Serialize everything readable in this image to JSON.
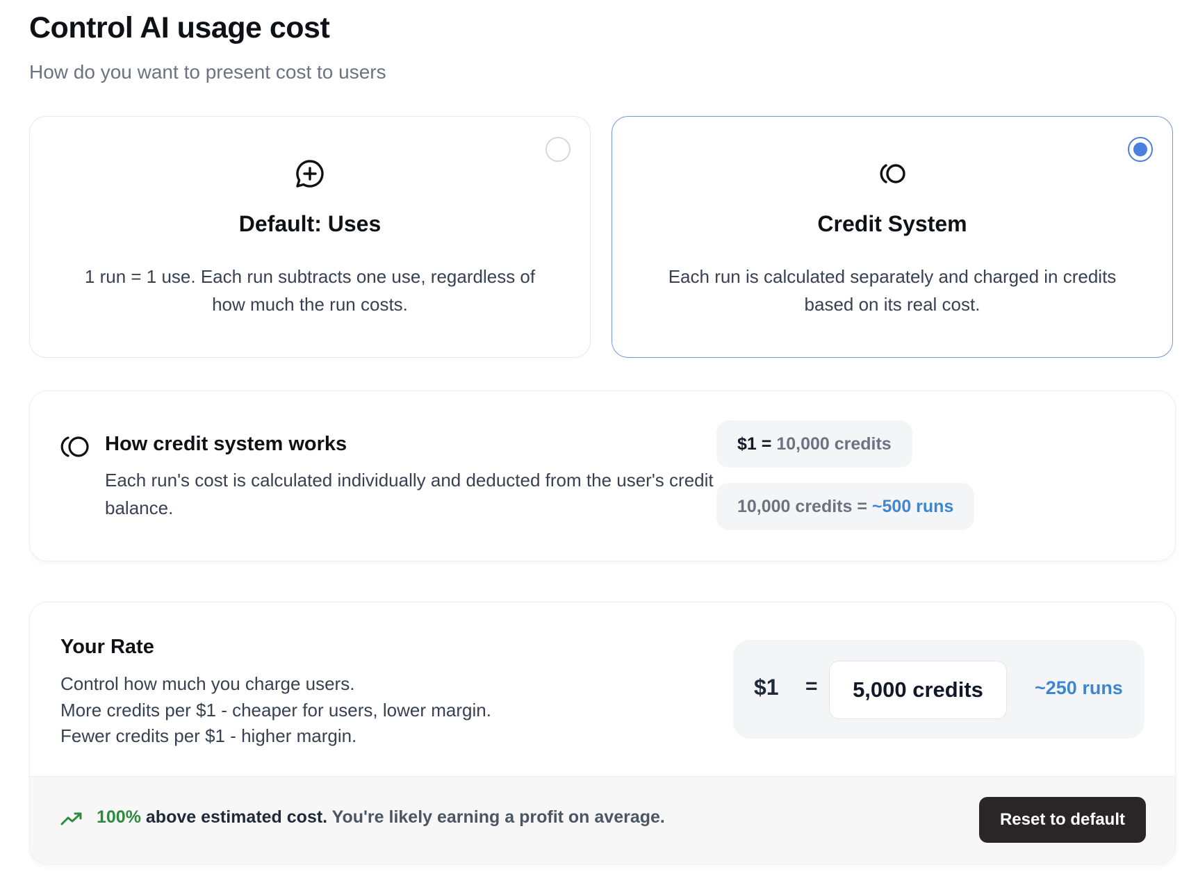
{
  "header": {
    "title": "Control AI usage cost",
    "subtitle": "How do you want to present cost to users"
  },
  "options": [
    {
      "icon": "message-plus-icon",
      "title": "Default: Uses",
      "description": "1 run = 1 use. Each run subtracts one use, regardless of how much the run costs.",
      "selected": false
    },
    {
      "icon": "credits-icon",
      "title": "Credit System",
      "description": "Each run is calculated separately and charged in credits based on its real cost.",
      "selected": true
    }
  ],
  "info": {
    "icon": "credits-icon",
    "title": "How credit system works",
    "description": "Each run's cost is calculated individually and deducted from the user's credit balance.",
    "pill_1": {
      "dollar": "$1",
      "equals": " = ",
      "credits": "10,000 credits"
    },
    "pill_2": {
      "credits": "10,000 credits",
      "equals": " = ",
      "runs": "~500 runs"
    }
  },
  "rate": {
    "title": "Your Rate",
    "line_1": "Control how much you charge users.",
    "line_2": "More credits per $1 - cheaper for users, lower margin.",
    "line_3": "Fewer credits per $1 - higher margin.",
    "dollar": "$1",
    "equals": "=",
    "credits_value": "5,000 credits",
    "runs": "~250 runs"
  },
  "footer": {
    "icon": "trending-up-icon",
    "percent": "100%",
    "above_text": "above estimated cost.",
    "profit_text": "You're likely earning a profit on average.",
    "reset_label": "Reset to default"
  },
  "colors": {
    "accent_blue": "#4a7fe0",
    "link_blue": "#3f86d0",
    "profit_green": "#2f8a3f",
    "button_dark": "#2a2628"
  }
}
